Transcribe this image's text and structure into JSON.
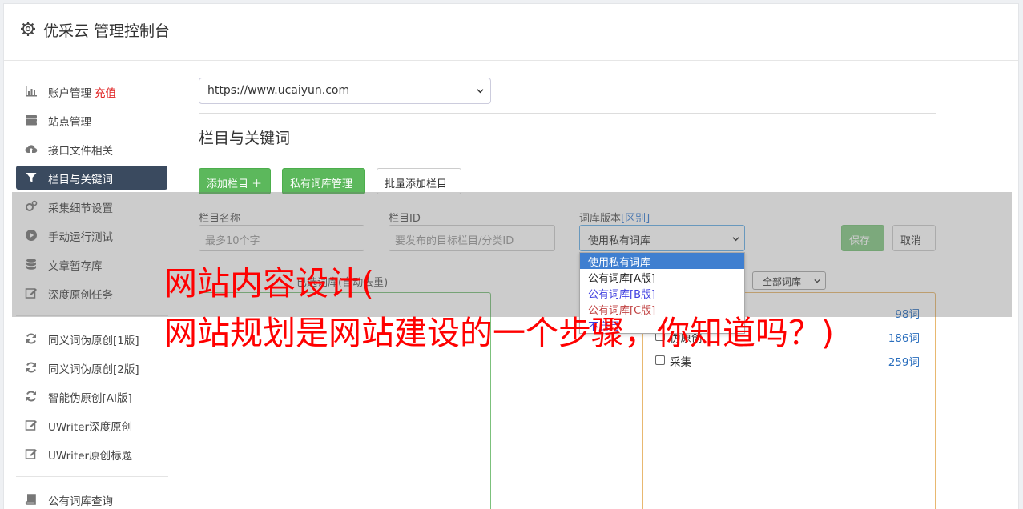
{
  "app": {
    "title": "优采云 管理控制台",
    "icon": "gear-icon"
  },
  "sidebar": {
    "items": [
      {
        "label": "账户管理",
        "badge": "充值",
        "icon": "bar-chart-icon"
      },
      {
        "label": "站点管理",
        "icon": "server-icon"
      },
      {
        "label": "接口文件相关",
        "icon": "cloud-upload-icon"
      },
      {
        "label": "栏目与关键词",
        "icon": "filter-icon",
        "active": true
      },
      {
        "label": "采集细节设置",
        "icon": "cogs-icon"
      },
      {
        "label": "手动运行测试",
        "icon": "play-circle-icon"
      },
      {
        "label": "文章暂存库",
        "icon": "database-icon"
      },
      {
        "label": "深度原创任务",
        "icon": "edit-icon"
      },
      {
        "label": "同义词伪原创[1版]",
        "icon": "refresh-icon"
      },
      {
        "label": "同义词伪原创[2版]",
        "icon": "refresh-icon"
      },
      {
        "label": "智能伪原创[AI版]",
        "icon": "refresh-icon"
      },
      {
        "label": "UWriter深度原创",
        "icon": "edit-icon"
      },
      {
        "label": "UWriter原创标题",
        "icon": "edit-icon"
      },
      {
        "label": "公有词库查询",
        "icon": "book-icon"
      }
    ]
  },
  "site_select": {
    "value": "https://www.ucaiyun.com"
  },
  "section": {
    "title": "栏目与关键词"
  },
  "toolbar": {
    "add_column": "添加栏目 ＋",
    "private_lib": "私有词库管理",
    "batch_add": "批量添加栏目"
  },
  "form": {
    "column_name_label": "栏目名称",
    "column_name_placeholder": "最多10个字",
    "column_id_label": "栏目ID",
    "column_id_placeholder": "要发布的目标栏目/分类ID",
    "lib_version_label": "词库版本",
    "lib_version_link": "[区别]",
    "lib_version_value": "使用私有词库",
    "save": "保存",
    "cancel": "取消"
  },
  "dropdown": {
    "options": [
      "使用私有词库",
      "公有词库[A版]",
      "公有词库[B版]",
      "公有词库[C版]",
      "不启用"
    ]
  },
  "panels": {
    "left_label": "已选词库(自动去重)",
    "right_filter": "全部词库",
    "libraries": [
      {
        "name": "",
        "count": "98词"
      },
      {
        "name": "伪原创",
        "count": "186词"
      },
      {
        "name": "采集",
        "count": "259词"
      }
    ]
  },
  "overlay": {
    "line1": "网站内容设计(",
    "line2": "网站规划是网站建设的一个步骤，你知道吗？)"
  },
  "colors": {
    "accent_green": "#5cb85c",
    "active_nav": "#3a4a5f",
    "headline": "#ff0000"
  }
}
